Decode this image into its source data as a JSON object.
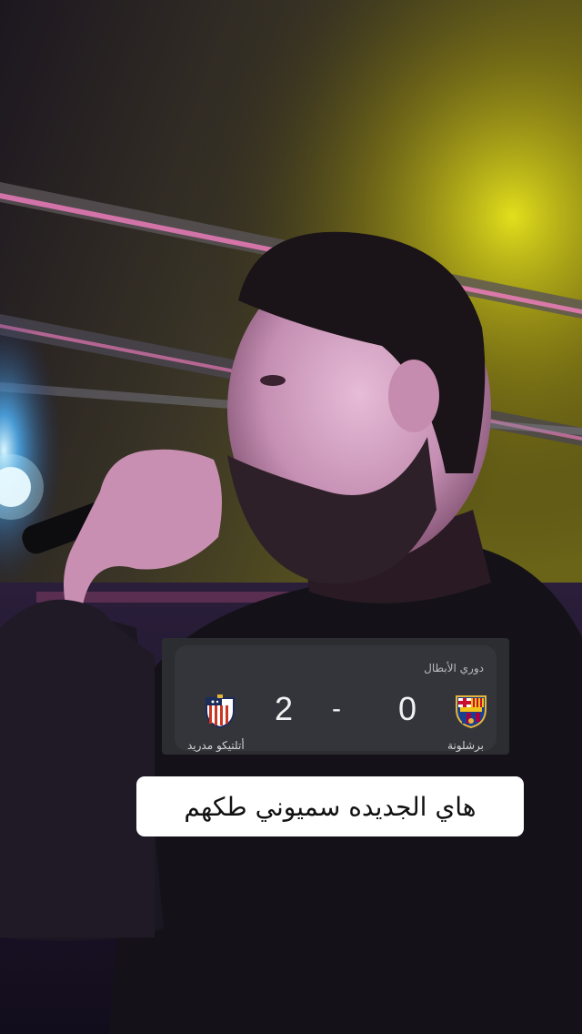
{
  "scoreboard": {
    "competition": "دوري الأبطال",
    "home_team": "برشلونة",
    "away_team": "أتلتيكو مدريد",
    "home_score": "0",
    "away_score": "2",
    "separator": "-"
  },
  "caption": {
    "text": "هاي الجديده سميوني طكهم"
  },
  "colors": {
    "card": "#34353a",
    "caption_bg": "#ffffff",
    "neon_yellow": "#e8e61a",
    "neon_pink": "#ff7fc6",
    "stage_light": "#8fd8ff"
  }
}
